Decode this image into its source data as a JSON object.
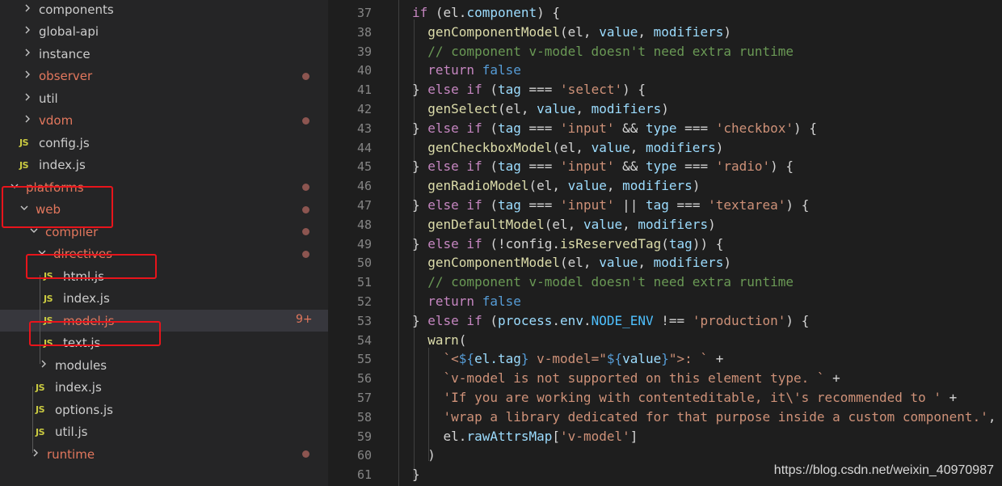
{
  "explorer": {
    "items": [
      {
        "label": "components",
        "kind": "folder",
        "modified": false,
        "dot": false
      },
      {
        "label": "global-api",
        "kind": "folder",
        "modified": false,
        "dot": false
      },
      {
        "label": "instance",
        "kind": "folder",
        "modified": false,
        "dot": false
      },
      {
        "label": "observer",
        "kind": "folder",
        "modified": true,
        "dot": true
      },
      {
        "label": "util",
        "kind": "folder",
        "modified": false,
        "dot": false
      },
      {
        "label": "vdom",
        "kind": "folder",
        "modified": true,
        "dot": true
      },
      {
        "label": "config.js",
        "kind": "file",
        "modified": false,
        "dot": false
      },
      {
        "label": "index.js",
        "kind": "file",
        "modified": false,
        "dot": false
      },
      {
        "label": "platforms",
        "kind": "folder-open",
        "modified": true,
        "dot": true
      },
      {
        "label": "web",
        "kind": "folder-open",
        "modified": true,
        "dot": true
      },
      {
        "label": "compiler",
        "kind": "folder-open",
        "modified": true,
        "dot": true
      },
      {
        "label": "directives",
        "kind": "folder-open",
        "modified": true,
        "dot": true
      },
      {
        "label": "html.js",
        "kind": "file",
        "modified": false,
        "dot": false
      },
      {
        "label": "index.js",
        "kind": "file",
        "modified": false,
        "dot": false
      },
      {
        "label": "model.js",
        "kind": "file",
        "modified": true,
        "dot": false,
        "badge": "9+"
      },
      {
        "label": "text.js",
        "kind": "file",
        "modified": false,
        "dot": false
      },
      {
        "label": "modules",
        "kind": "folder",
        "modified": false,
        "dot": false
      },
      {
        "label": "index.js",
        "kind": "file",
        "modified": false,
        "dot": false
      },
      {
        "label": "options.js",
        "kind": "file",
        "modified": false,
        "dot": false
      },
      {
        "label": "util.js",
        "kind": "file",
        "modified": false,
        "dot": false
      },
      {
        "label": "runtime",
        "kind": "folder",
        "modified": true,
        "dot": true
      }
    ],
    "file_icon_text": "JS",
    "chevron_right": "›",
    "chevron_down": "⌄"
  },
  "editor": {
    "line_numbers": [
      "37",
      "38",
      "39",
      "40",
      "41",
      "42",
      "43",
      "44",
      "45",
      "46",
      "47",
      "48",
      "49",
      "50",
      "51",
      "52",
      "53",
      "54",
      "55",
      "56",
      "57",
      "58",
      "59",
      "60",
      "61"
    ],
    "lines": [
      [
        [
          "k",
          "if"
        ],
        [
          "p",
          " (el."
        ],
        [
          "v",
          "component"
        ],
        [
          "p",
          ") {"
        ]
      ],
      [
        [
          "p",
          "  "
        ],
        [
          "fn",
          "genComponentModel"
        ],
        [
          "p",
          "(el, "
        ],
        [
          "v",
          "value"
        ],
        [
          "p",
          ", "
        ],
        [
          "v",
          "modifiers"
        ],
        [
          "p",
          ")"
        ]
      ],
      [
        [
          "p",
          "  "
        ],
        [
          "c",
          "// component v-model doesn't need extra runtime"
        ]
      ],
      [
        [
          "p",
          "  "
        ],
        [
          "k",
          "return"
        ],
        [
          "p",
          " "
        ],
        [
          "kb",
          "false"
        ]
      ],
      [
        [
          "p",
          "} "
        ],
        [
          "k",
          "else if"
        ],
        [
          "p",
          " ("
        ],
        [
          "v",
          "tag"
        ],
        [
          "p",
          " === "
        ],
        [
          "s",
          "'select'"
        ],
        [
          "p",
          ") {"
        ]
      ],
      [
        [
          "p",
          "  "
        ],
        [
          "fn",
          "genSelect"
        ],
        [
          "p",
          "(el, "
        ],
        [
          "v",
          "value"
        ],
        [
          "p",
          ", "
        ],
        [
          "v",
          "modifiers"
        ],
        [
          "p",
          ")"
        ]
      ],
      [
        [
          "p",
          "} "
        ],
        [
          "k",
          "else if"
        ],
        [
          "p",
          " ("
        ],
        [
          "v",
          "tag"
        ],
        [
          "p",
          " === "
        ],
        [
          "s",
          "'input'"
        ],
        [
          "p",
          " && "
        ],
        [
          "v",
          "type"
        ],
        [
          "p",
          " === "
        ],
        [
          "s",
          "'checkbox'"
        ],
        [
          "p",
          ") {"
        ]
      ],
      [
        [
          "p",
          "  "
        ],
        [
          "fn",
          "genCheckboxModel"
        ],
        [
          "p",
          "(el, "
        ],
        [
          "v",
          "value"
        ],
        [
          "p",
          ", "
        ],
        [
          "v",
          "modifiers"
        ],
        [
          "p",
          ")"
        ]
      ],
      [
        [
          "p",
          "} "
        ],
        [
          "k",
          "else if"
        ],
        [
          "p",
          " ("
        ],
        [
          "v",
          "tag"
        ],
        [
          "p",
          " === "
        ],
        [
          "s",
          "'input'"
        ],
        [
          "p",
          " && "
        ],
        [
          "v",
          "type"
        ],
        [
          "p",
          " === "
        ],
        [
          "s",
          "'radio'"
        ],
        [
          "p",
          ") {"
        ]
      ],
      [
        [
          "p",
          "  "
        ],
        [
          "fn",
          "genRadioModel"
        ],
        [
          "p",
          "(el, "
        ],
        [
          "v",
          "value"
        ],
        [
          "p",
          ", "
        ],
        [
          "v",
          "modifiers"
        ],
        [
          "p",
          ")"
        ]
      ],
      [
        [
          "p",
          "} "
        ],
        [
          "k",
          "else if"
        ],
        [
          "p",
          " ("
        ],
        [
          "v",
          "tag"
        ],
        [
          "p",
          " === "
        ],
        [
          "s",
          "'input'"
        ],
        [
          "p",
          " || "
        ],
        [
          "v",
          "tag"
        ],
        [
          "p",
          " === "
        ],
        [
          "s",
          "'textarea'"
        ],
        [
          "p",
          ") {"
        ]
      ],
      [
        [
          "p",
          "  "
        ],
        [
          "fn",
          "genDefaultModel"
        ],
        [
          "p",
          "(el, "
        ],
        [
          "v",
          "value"
        ],
        [
          "p",
          ", "
        ],
        [
          "v",
          "modifiers"
        ],
        [
          "p",
          ")"
        ]
      ],
      [
        [
          "p",
          "} "
        ],
        [
          "k",
          "else if"
        ],
        [
          "p",
          " (!config."
        ],
        [
          "fn",
          "isReservedTag"
        ],
        [
          "p",
          "("
        ],
        [
          "v",
          "tag"
        ],
        [
          "p",
          ")) {"
        ]
      ],
      [
        [
          "p",
          "  "
        ],
        [
          "fn",
          "genComponentModel"
        ],
        [
          "p",
          "(el, "
        ],
        [
          "v",
          "value"
        ],
        [
          "p",
          ", "
        ],
        [
          "v",
          "modifiers"
        ],
        [
          "p",
          ")"
        ]
      ],
      [
        [
          "p",
          "  "
        ],
        [
          "c",
          "// component v-model doesn't need extra runtime"
        ]
      ],
      [
        [
          "p",
          "  "
        ],
        [
          "k",
          "return"
        ],
        [
          "p",
          " "
        ],
        [
          "kb",
          "false"
        ]
      ],
      [
        [
          "p",
          "} "
        ],
        [
          "k",
          "else if"
        ],
        [
          "p",
          " ("
        ],
        [
          "v",
          "process"
        ],
        [
          "p",
          "."
        ],
        [
          "v",
          "env"
        ],
        [
          "p",
          "."
        ],
        [
          "cst",
          "NODE_ENV"
        ],
        [
          "p",
          " !== "
        ],
        [
          "s",
          "'production'"
        ],
        [
          "p",
          ") {"
        ]
      ],
      [
        [
          "p",
          "  "
        ],
        [
          "fn",
          "warn"
        ],
        [
          "p",
          "("
        ]
      ],
      [
        [
          "p",
          "    "
        ],
        [
          "s",
          "`<"
        ],
        [
          "kb",
          "${"
        ],
        [
          "v",
          "el.tag"
        ],
        [
          "kb",
          "}"
        ],
        [
          "s",
          " v-model=\""
        ],
        [
          "kb",
          "${"
        ],
        [
          "v",
          "value"
        ],
        [
          "kb",
          "}"
        ],
        [
          "s",
          "\">: `"
        ],
        [
          "p",
          " +"
        ]
      ],
      [
        [
          "p",
          "    "
        ],
        [
          "s",
          "`v-model is not supported on this element type. `"
        ],
        [
          "p",
          " +"
        ]
      ],
      [
        [
          "p",
          "    "
        ],
        [
          "s",
          "'If you are working with contenteditable, it\\'s recommended to '"
        ],
        [
          "p",
          " +"
        ]
      ],
      [
        [
          "p",
          "    "
        ],
        [
          "s",
          "'wrap a library dedicated for that purpose inside a custom component.'"
        ],
        [
          "p",
          ","
        ]
      ],
      [
        [
          "p",
          "    el."
        ],
        [
          "v",
          "rawAttrsMap"
        ],
        [
          "p",
          "["
        ],
        [
          "s",
          "'v-model'"
        ],
        [
          "p",
          "]"
        ]
      ],
      [
        [
          "p",
          "  )"
        ]
      ],
      [
        [
          "p",
          "}"
        ]
      ]
    ]
  },
  "watermark": "https://blog.csdn.net/weixin_40970987",
  "colors": {
    "sidebar_bg": "#252526",
    "editor_bg": "#1e1e1e",
    "modified_text": "#e2775d",
    "highlight_box": "#e8141b",
    "js_icon": "#cbcb41"
  }
}
